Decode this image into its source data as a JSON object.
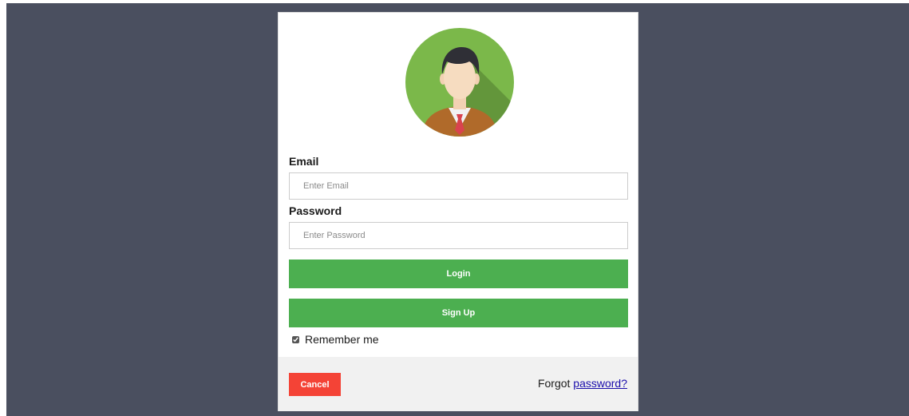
{
  "form": {
    "email_label": "Email",
    "email_placeholder": "Enter Email",
    "email_value": "",
    "password_label": "Password",
    "password_placeholder": "Enter Password",
    "password_value": "",
    "login_label": "Login",
    "signup_label": "Sign Up",
    "remember_label": "Remember me",
    "remember_checked": true
  },
  "footer": {
    "cancel_label": "Cancel",
    "forgot_prefix": "Forgot",
    "forgot_link": "password?"
  },
  "colors": {
    "overlay": "#4a4f5f",
    "button_green": "#4caf50",
    "cancel_red": "#f44336",
    "footer_bg": "#f1f1f1",
    "link": "#1a0dab"
  },
  "icons": {
    "avatar": "user-avatar-icon"
  }
}
